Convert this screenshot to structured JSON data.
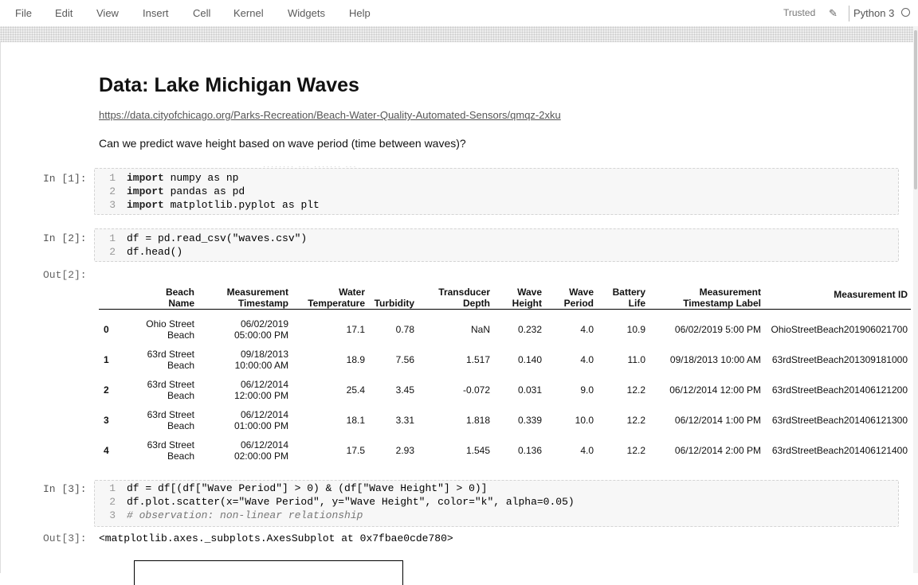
{
  "menu": [
    "File",
    "Edit",
    "View",
    "Insert",
    "Cell",
    "Kernel",
    "Widgets",
    "Help"
  ],
  "toolbar": {
    "trusted": "Trusted",
    "kernel": "Python 3"
  },
  "markdown": {
    "title": "Data: Lake Michigan Waves",
    "link": "https://data.cityofchicago.org/Parks-Recreation/Beach-Water-Quality-Automated-Sensors/qmqz-2xku",
    "question": "Can we predict wave height based on wave period (time between waves)?"
  },
  "cells": [
    {
      "prompt": "In [1]:",
      "lines": [
        {
          "n": "1",
          "kw": "import",
          "rest": " numpy as np"
        },
        {
          "n": "2",
          "kw": "import",
          "rest": " pandas as pd"
        },
        {
          "n": "3",
          "kw": "import",
          "rest": " matplotlib.pyplot as plt"
        }
      ]
    },
    {
      "prompt": "In [2]:",
      "lines": [
        {
          "n": "1",
          "kw": "",
          "rest": "df = pd.read_csv(\"waves.csv\")"
        },
        {
          "n": "2",
          "kw": "",
          "rest": "df.head()"
        }
      ],
      "out_prompt": "Out[2]:"
    },
    {
      "prompt": "In [3]:",
      "lines": [
        {
          "n": "1",
          "kw": "",
          "rest": "df = df[(df[\"Wave Period\"] > 0) & (df[\"Wave Height\"] > 0)]"
        },
        {
          "n": "2",
          "kw": "",
          "rest": "df.plot.scatter(x=\"Wave Period\", y=\"Wave Height\", color=\"k\", alpha=0.05)"
        },
        {
          "n": "3",
          "kw": "",
          "rest": "# observation: non-linear relationship",
          "comment": true
        }
      ],
      "out_prompt": "Out[3]:",
      "out_text": "<matplotlib.axes._subplots.AxesSubplot at 0x7fbae0cde780>"
    }
  ],
  "table": {
    "columns": [
      [
        "Beach",
        "Name"
      ],
      [
        "Measurement",
        "Timestamp"
      ],
      [
        "Water",
        "Temperature"
      ],
      [
        "Turbidity",
        ""
      ],
      [
        "Transducer",
        "Depth"
      ],
      [
        "Wave",
        "Height"
      ],
      [
        "Wave",
        "Period"
      ],
      [
        "Battery",
        "Life"
      ],
      [
        "Measurement",
        "Timestamp Label"
      ],
      [
        "Measurement ID",
        ""
      ]
    ],
    "rows": [
      {
        "idx": "0",
        "beach": [
          "Ohio Street",
          "Beach"
        ],
        "ts": [
          "06/02/2019",
          "05:00:00 PM"
        ],
        "water": "17.1",
        "turb": "0.78",
        "depth": "NaN",
        "height": "0.232",
        "period": "4.0",
        "battery": "10.9",
        "label": "06/02/2019 5:00 PM",
        "id": "OhioStreetBeach201906021700"
      },
      {
        "idx": "1",
        "beach": [
          "63rd Street",
          "Beach"
        ],
        "ts": [
          "09/18/2013",
          "10:00:00 AM"
        ],
        "water": "18.9",
        "turb": "7.56",
        "depth": "1.517",
        "height": "0.140",
        "period": "4.0",
        "battery": "11.0",
        "label": "09/18/2013 10:00 AM",
        "id": "63rdStreetBeach201309181000"
      },
      {
        "idx": "2",
        "beach": [
          "63rd Street",
          "Beach"
        ],
        "ts": [
          "06/12/2014",
          "12:00:00 PM"
        ],
        "water": "25.4",
        "turb": "3.45",
        "depth": "-0.072",
        "height": "0.031",
        "period": "9.0",
        "battery": "12.2",
        "label": "06/12/2014 12:00 PM",
        "id": "63rdStreetBeach201406121200"
      },
      {
        "idx": "3",
        "beach": [
          "63rd Street",
          "Beach"
        ],
        "ts": [
          "06/12/2014",
          "01:00:00 PM"
        ],
        "water": "18.1",
        "turb": "3.31",
        "depth": "1.818",
        "height": "0.339",
        "period": "10.0",
        "battery": "12.2",
        "label": "06/12/2014 1:00 PM",
        "id": "63rdStreetBeach201406121300"
      },
      {
        "idx": "4",
        "beach": [
          "63rd Street",
          "Beach"
        ],
        "ts": [
          "06/12/2014",
          "02:00:00 PM"
        ],
        "water": "17.5",
        "turb": "2.93",
        "depth": "1.545",
        "height": "0.136",
        "period": "4.0",
        "battery": "12.2",
        "label": "06/12/2014 2:00 PM",
        "id": "63rdStreetBeach201406121400"
      }
    ]
  }
}
